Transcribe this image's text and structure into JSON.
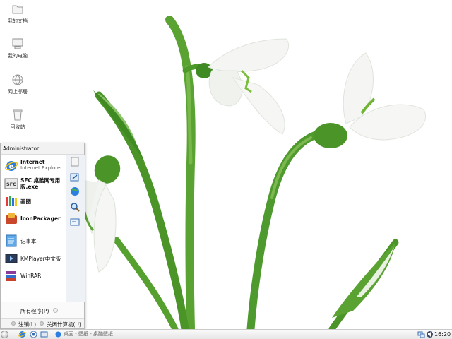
{
  "desktop": {
    "icons": [
      {
        "label": "我的文档",
        "icon": "folder-icon"
      },
      {
        "label": "我的电脑",
        "icon": "computer-icon"
      },
      {
        "label": "网上邻居",
        "icon": "network-icon"
      },
      {
        "label": "回收站",
        "icon": "recycle-bin-icon"
      }
    ]
  },
  "start_menu": {
    "user": "Administrator",
    "pinned": [
      {
        "title": "Internet",
        "subtitle": "Internet Explorer",
        "icon": "internet-explorer-icon"
      },
      {
        "title": "SFC 桌酷网专用",
        "subtitle": "版.exe",
        "icon": "sfc-icon"
      }
    ],
    "recent": [
      {
        "label": "画图",
        "icon": "paint-icon"
      },
      {
        "label": "IconPackager",
        "icon": "iconpackager-icon"
      },
      {
        "label": "记事本",
        "icon": "notepad-icon"
      },
      {
        "label": "KMPlayer中文版",
        "icon": "kmplayer-icon"
      },
      {
        "label": "WinRAR",
        "icon": "winrar-icon"
      }
    ],
    "right_icons": [
      "documents-icon",
      "control-panel-icon",
      "internet-icon",
      "search-icon",
      "run-icon"
    ],
    "all_programs": "所有程序(P)",
    "logoff": "注销(L)",
    "shutdown": "关闭计算机(U)"
  },
  "taskbar": {
    "task_label": "桌面 - 壁纸 - 桌酷壁纸...",
    "clock": "16:20"
  },
  "colors": {
    "stem_green": "#4f9a2e",
    "leaf_green": "#3f8a22",
    "petal": "#f3f5f2",
    "ie_blue": "#1f6fd1"
  }
}
